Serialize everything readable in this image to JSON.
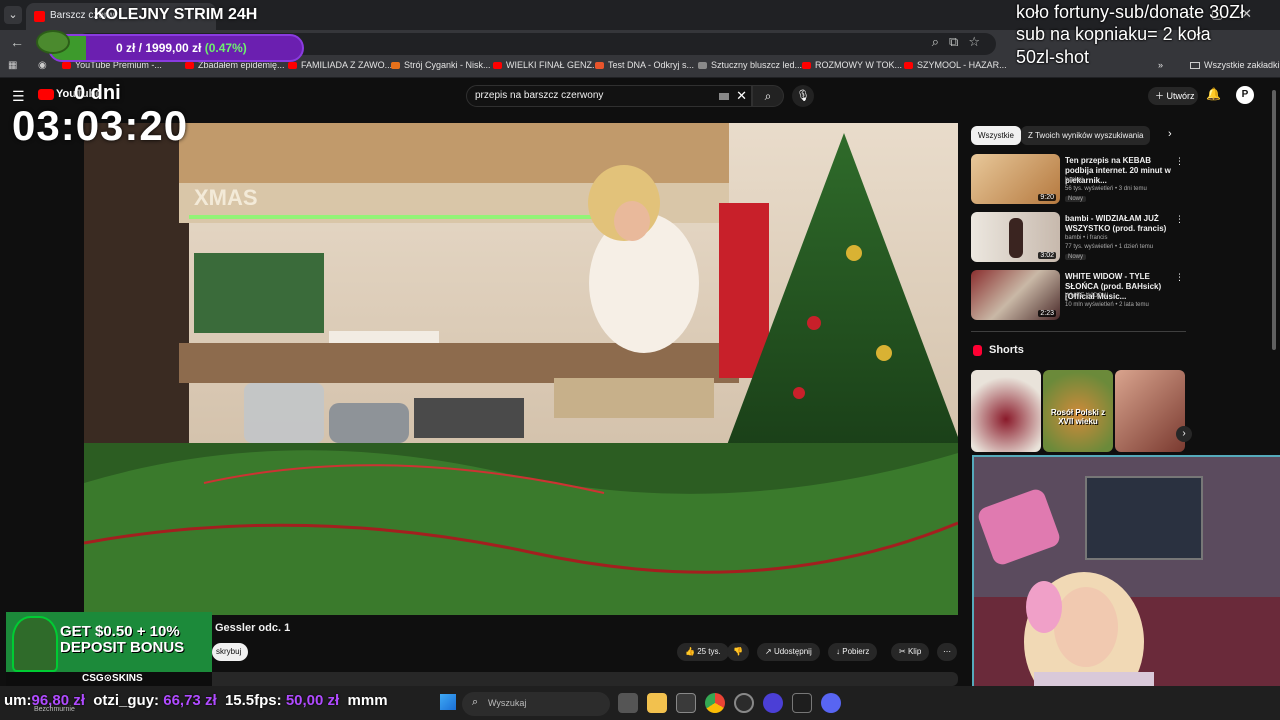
{
  "browser": {
    "tab_title": "Barszcz czerw",
    "bookmarks": [
      "YouTube Premium -...",
      "Zbadałem epidemię...",
      "FAMILIADA Z ZAWO...",
      "Strój Cyganki - Nisk...",
      "WIELKI FINAŁ GENZ...",
      "Test DNA - Odkryj s...",
      "Sztuczny bluszcz led...",
      "ROZMOWY W TOK...",
      "SZYMOOL - HAZAR...",
      "Wszystkie zakładki"
    ],
    "more_chevron": "»"
  },
  "youtube": {
    "logo_text": "YouTube",
    "search_query": "przepis na barszcz czerwony",
    "create_label": "Utwórz",
    "avatar_letter": "P",
    "video_title_partial": "Gessler odc. 1",
    "subscribe_label": "skrybuj",
    "actions": {
      "likes": "25 tys.",
      "share": "Udostępnij",
      "download": "Pobierz",
      "clip": "Klip"
    },
    "chips": [
      "Wszystkie",
      "Z Twoich wyników wyszukiwania"
    ],
    "recommendations": [
      {
        "title": "Ten przepis na KEBAB podbija internet. 20 minut w piekarnik...",
        "channel": "bonkol",
        "meta": "56 tys. wyświetleń • 3 dni temu",
        "badge": "Nowy",
        "duration": "9:20"
      },
      {
        "title": "bambi - WIDZIAŁAM JUŻ WSZYSTKO (prod. francis)",
        "channel": "bambi • i francis",
        "meta": "77 tys. wyświetleń • 1 dzień temu",
        "badge": "Nowy",
        "duration": "3:02"
      },
      {
        "title": "WHITE WIDOW - TYLE SŁOŃCA (prod. BAHsick) [Official Music...",
        "channel": "WHITE WIDOW",
        "meta": "10 mln wyświetleń • 2 lata temu",
        "badge": "",
        "duration": "2:23"
      }
    ],
    "shorts_label": "Shorts",
    "short_caption": "Rosół Polski z XVII wieku"
  },
  "overlay": {
    "strim_title": "KOLEJNY STRIM 24H",
    "goal_text": "0 zł / 1999,00 zł",
    "goal_percent_text": "(0.47%)",
    "goal_fraction": 0.0047,
    "timer_days": "0 dni",
    "timer_clock": "03:03:20",
    "promo_lines": [
      "koło fortuny-sub/donate 30Zł",
      "sub na kopniaku= 2 koła",
      "50zl-shot"
    ],
    "ad_text": "GET $0.50 + 10% DEPOSIT BONUS",
    "ad_brand": "CSG⊙SKINS",
    "ticker": [
      {
        "name": "um:",
        "amount": "96,80 zł"
      },
      {
        "name": "otzi_guy:",
        "amount": "66,73 zł"
      },
      {
        "name": "15.5fps:",
        "amount": "50,00 zł"
      },
      {
        "name": "mmm",
        "amount": ""
      }
    ],
    "ticker_sub": "Bezchmurnie"
  },
  "taskbar": {
    "search_placeholder": "Wyszukaj"
  }
}
